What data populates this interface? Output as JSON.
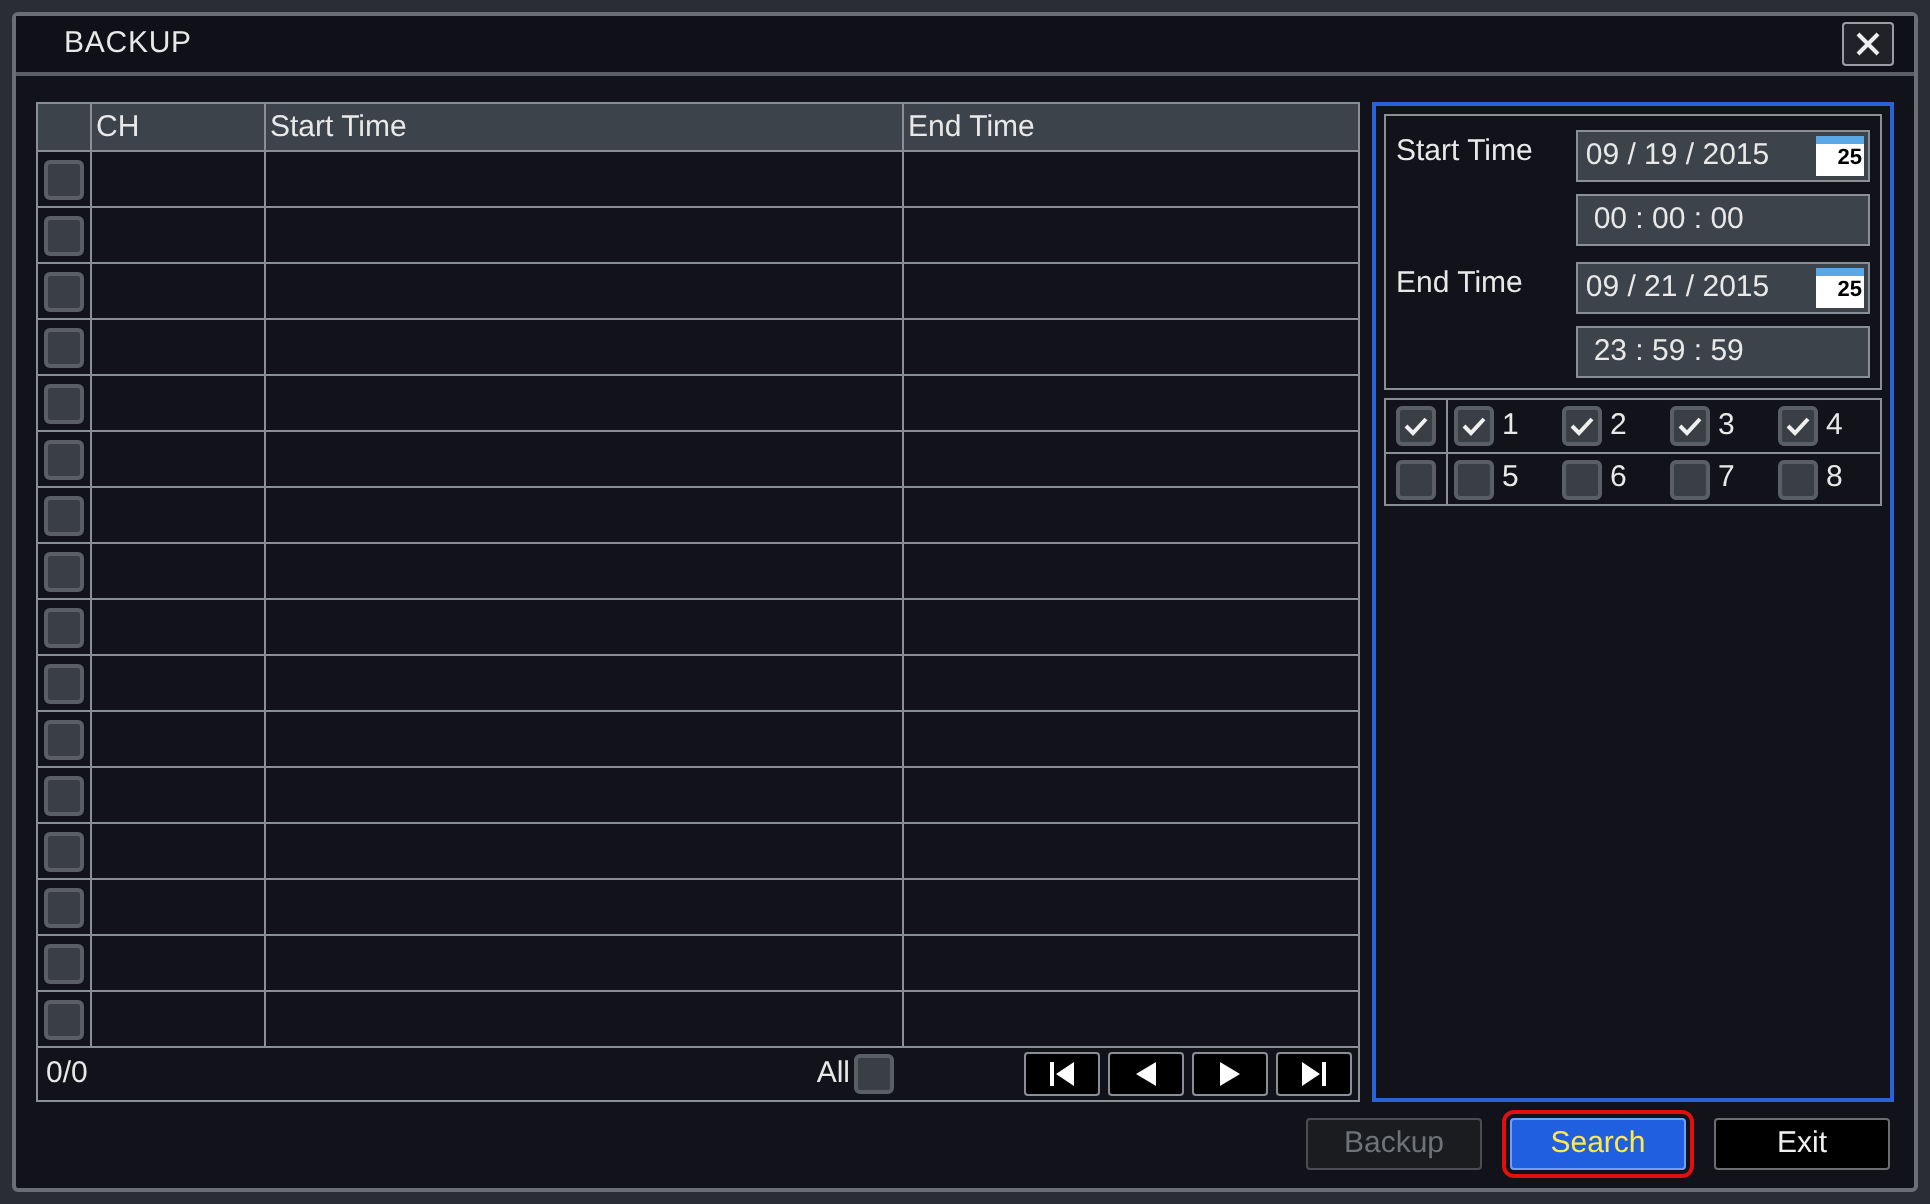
{
  "window": {
    "title": "BACKUP"
  },
  "table": {
    "columns": [
      "CH",
      "Start Time",
      "End Time"
    ],
    "rows": [
      {
        "checked": false
      },
      {
        "checked": false
      },
      {
        "checked": false
      },
      {
        "checked": false
      },
      {
        "checked": false
      },
      {
        "checked": false
      },
      {
        "checked": false
      },
      {
        "checked": false
      },
      {
        "checked": false
      },
      {
        "checked": false
      },
      {
        "checked": false
      },
      {
        "checked": false
      },
      {
        "checked": false
      },
      {
        "checked": false
      },
      {
        "checked": false
      },
      {
        "checked": false
      }
    ],
    "page_count": "0/0",
    "select_all": {
      "label": "All",
      "checked": false
    }
  },
  "search_panel": {
    "start": {
      "label": "Start Time",
      "date": "09 / 19 / 2015",
      "time": "00 : 00 : 00",
      "calendar_day": "25"
    },
    "end": {
      "label": "End Time",
      "date": "09 / 21 / 2015",
      "time": "23 : 59 : 59",
      "calendar_day": "25"
    },
    "channel_rows": [
      {
        "all_checked": true,
        "channels": [
          {
            "label": "1",
            "checked": true
          },
          {
            "label": "2",
            "checked": true
          },
          {
            "label": "3",
            "checked": true
          },
          {
            "label": "4",
            "checked": true
          }
        ]
      },
      {
        "all_checked": false,
        "channels": [
          {
            "label": "5",
            "checked": false
          },
          {
            "label": "6",
            "checked": false
          },
          {
            "label": "7",
            "checked": false
          },
          {
            "label": "8",
            "checked": false
          }
        ]
      }
    ]
  },
  "buttons": [
    {
      "label": "Backup",
      "disabled": true,
      "selected": false
    },
    {
      "label": "Search",
      "disabled": false,
      "selected": true
    },
    {
      "label": "Exit",
      "disabled": false,
      "selected": false
    }
  ]
}
